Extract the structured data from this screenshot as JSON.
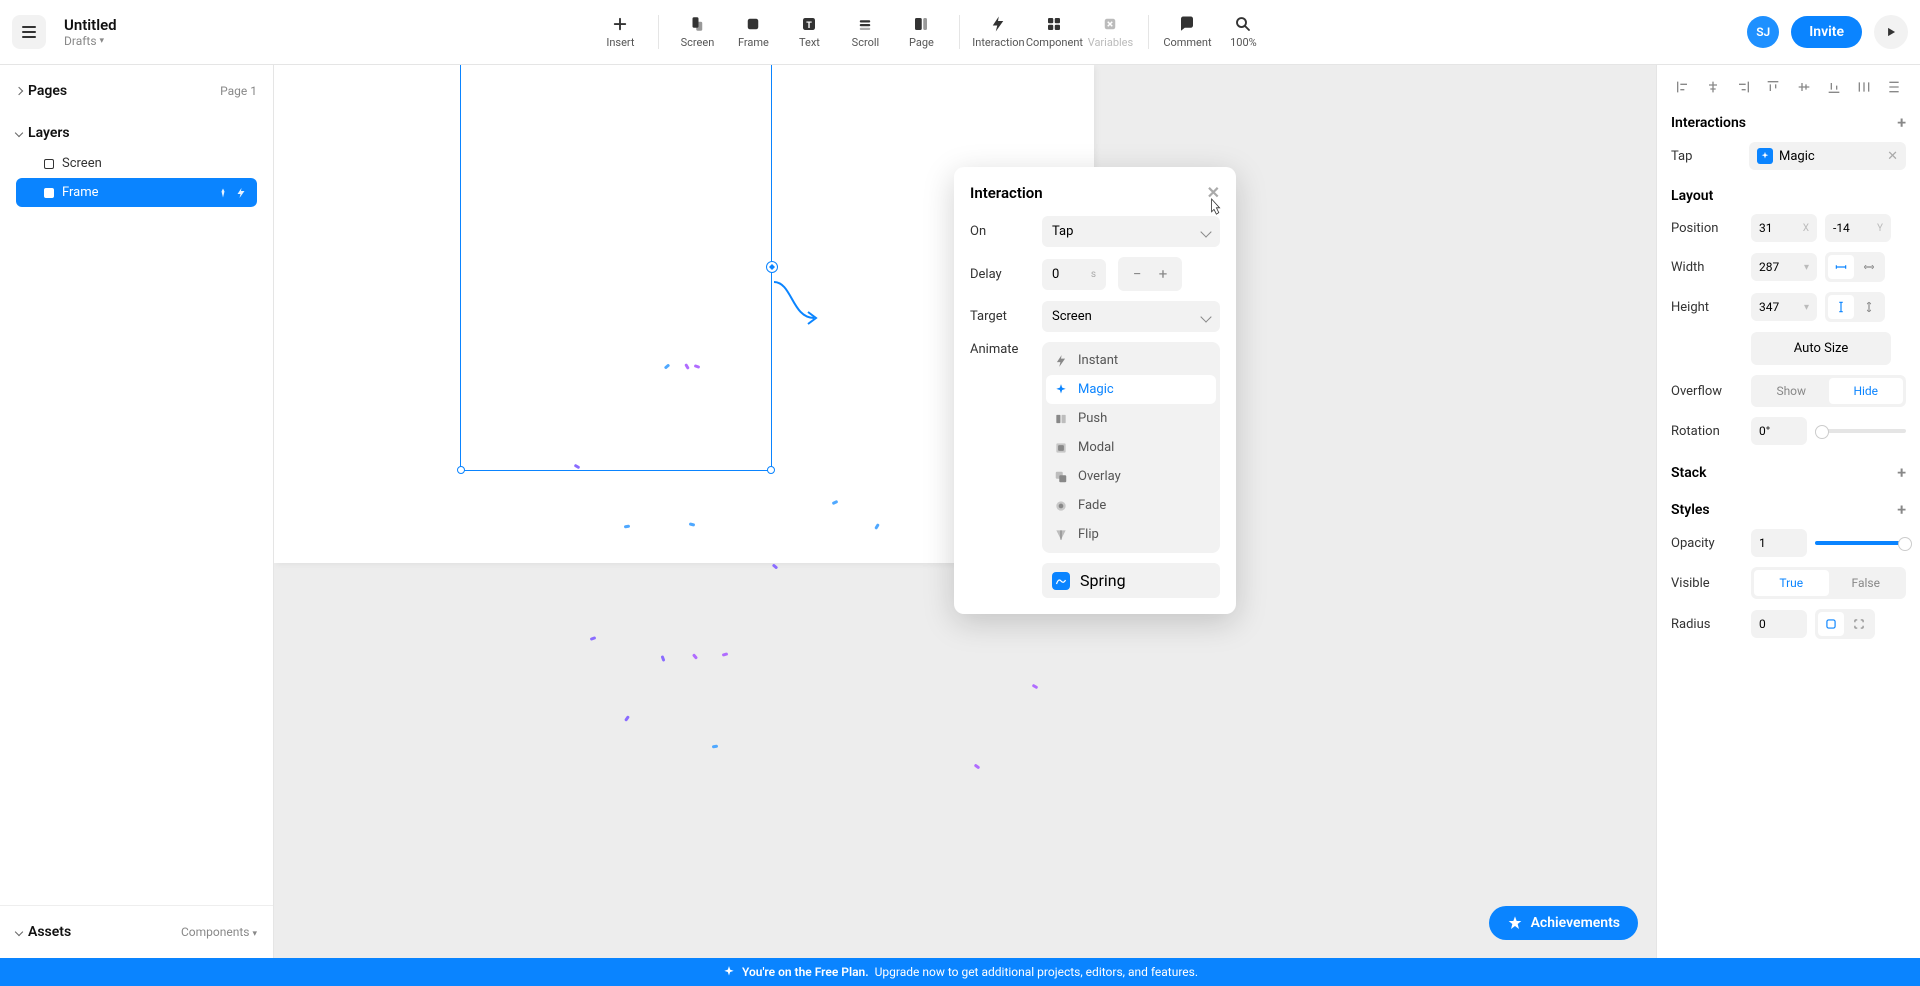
{
  "header": {
    "title": "Untitled",
    "subtitle": "Drafts",
    "avatar": "SJ",
    "invite_label": "Invite",
    "zoom": "100%"
  },
  "tools": {
    "insert": "Insert",
    "screen": "Screen",
    "frame": "Frame",
    "text": "Text",
    "scroll": "Scroll",
    "page": "Page",
    "interaction": "Interaction",
    "component": "Component",
    "variables": "Variables",
    "comment": "Comment"
  },
  "left": {
    "pages_label": "Pages",
    "page_indicator": "Page 1",
    "layers_label": "Layers",
    "layer_screen": "Screen",
    "layer_frame": "Frame",
    "assets_label": "Assets",
    "assets_sub": "Components"
  },
  "popover": {
    "title": "Interaction",
    "on_label": "On",
    "on_value": "Tap",
    "delay_label": "Delay",
    "delay_value": "0",
    "delay_unit": "s",
    "target_label": "Target",
    "target_value": "Screen",
    "animate_label": "Animate",
    "anim_instant": "Instant",
    "anim_magic": "Magic",
    "anim_push": "Push",
    "anim_modal": "Modal",
    "anim_overlay": "Overlay",
    "anim_fade": "Fade",
    "anim_flip": "Flip",
    "spring": "Spring"
  },
  "right": {
    "interactions_label": "Interactions",
    "tap_label": "Tap",
    "magic_chip": "Magic",
    "layout_label": "Layout",
    "position_label": "Position",
    "pos_x": "31",
    "pos_y": "-14",
    "width_label": "Width",
    "width_val": "287",
    "height_label": "Height",
    "height_val": "347",
    "auto_size": "Auto Size",
    "overflow_label": "Overflow",
    "overflow_show": "Show",
    "overflow_hide": "Hide",
    "rotation_label": "Rotation",
    "rotation_val": "0°",
    "stack_label": "Stack",
    "styles_label": "Styles",
    "opacity_label": "Opacity",
    "opacity_val": "1",
    "visible_label": "Visible",
    "visible_true": "True",
    "visible_false": "False",
    "radius_label": "Radius",
    "radius_val": "0"
  },
  "achievements_label": "Achievements",
  "banner": {
    "bold": "You're on the Free Plan.",
    "rest": "Upgrade now to get additional projects, editors, and features."
  }
}
